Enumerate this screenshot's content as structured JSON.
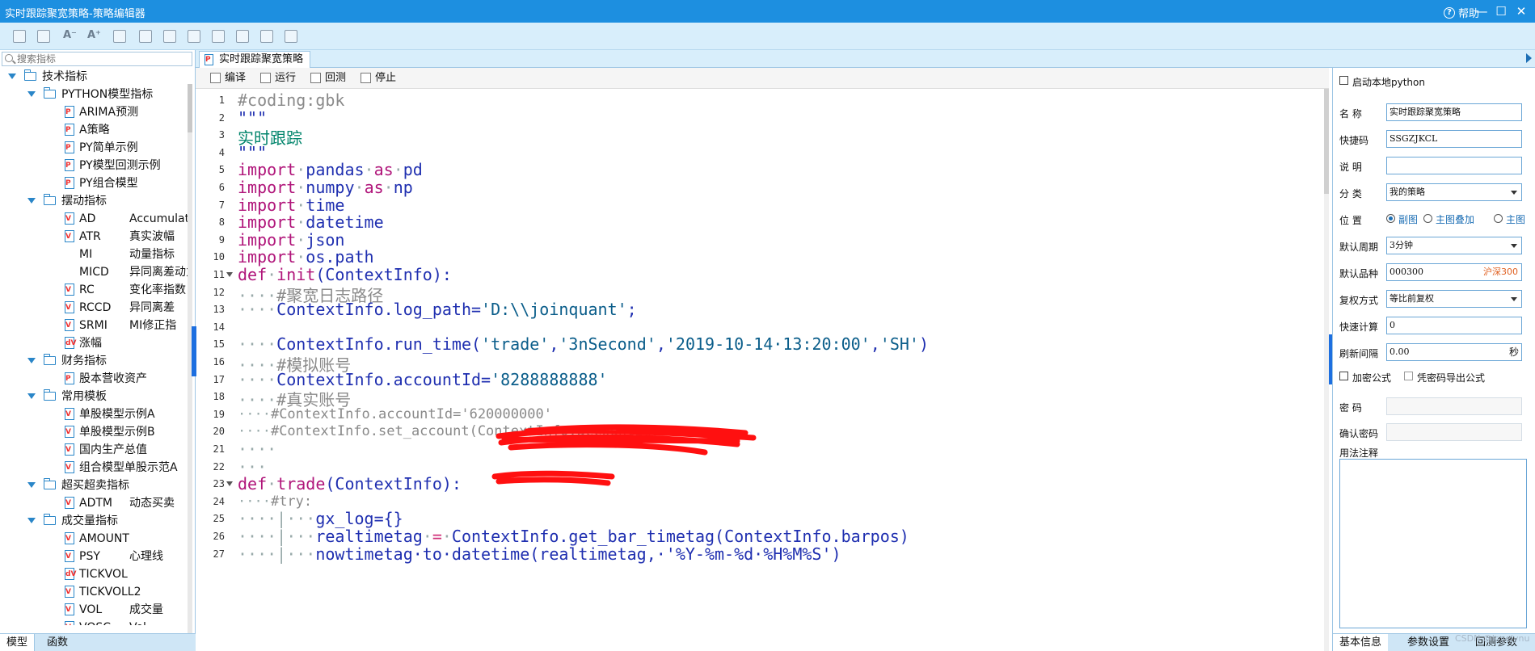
{
  "window": {
    "title": "实时跟踪聚宽策略-策略编辑器",
    "help_label": "帮助",
    "minimize_glyph": "—",
    "maximize_glyph": "☐",
    "close_glyph": "✕"
  },
  "toolbar": {
    "icons": [
      "save-icon",
      "save-all-icon",
      "font-decrease-icon",
      "font-increase-icon",
      "import-icon",
      "export-icon",
      "check-icon",
      "copy-icon",
      "paste-icon",
      "download-icon",
      "upload-icon",
      "lock-icon"
    ],
    "font_small": "A⁻",
    "font_large": "A⁺"
  },
  "left_panel": {
    "search_placeholder": "搜索指标",
    "tree": [
      {
        "level": 0,
        "type": "folder",
        "label": "技术指标"
      },
      {
        "level": 1,
        "type": "folder",
        "label": "PYTHON模型指标"
      },
      {
        "level": 2,
        "type": "doc",
        "mark": "P",
        "label": "ARIMA预测"
      },
      {
        "level": 2,
        "type": "doc",
        "mark": "P",
        "label": "A策略"
      },
      {
        "level": 2,
        "type": "doc",
        "mark": "P",
        "label": "PY简单示例"
      },
      {
        "level": 2,
        "type": "doc",
        "mark": "P",
        "label": "PY模型回测示例"
      },
      {
        "level": 2,
        "type": "doc",
        "mark": "P",
        "label": "PY组合模型"
      },
      {
        "level": 1,
        "type": "folder",
        "label": "摆动指标"
      },
      {
        "level": 2,
        "type": "doc",
        "mark": "V",
        "label": "AD",
        "desc": "Accumulat"
      },
      {
        "level": 2,
        "type": "doc",
        "mark": "V",
        "label": "ATR",
        "desc": "真实波幅"
      },
      {
        "level": 2,
        "type": "none",
        "label": "MI",
        "desc": "动量指标"
      },
      {
        "level": 2,
        "type": "none",
        "label": "MICD",
        "desc": "异同离差动力"
      },
      {
        "level": 2,
        "type": "doc",
        "mark": "V",
        "label": "RC",
        "desc": "变化率指数"
      },
      {
        "level": 2,
        "type": "doc",
        "mark": "V",
        "label": "RCCD",
        "desc": "异同离差"
      },
      {
        "level": 2,
        "type": "doc",
        "mark": "V",
        "label": "SRMI",
        "desc": "MI修正指"
      },
      {
        "level": 2,
        "type": "doc",
        "mark": "dV",
        "label": "涨幅"
      },
      {
        "level": 1,
        "type": "folder",
        "label": "财务指标"
      },
      {
        "level": 2,
        "type": "doc",
        "mark": "P",
        "label": "股本营收资产"
      },
      {
        "level": 1,
        "type": "folder",
        "label": "常用模板"
      },
      {
        "level": 2,
        "type": "doc",
        "mark": "V",
        "label": "单股模型示例A"
      },
      {
        "level": 2,
        "type": "doc",
        "mark": "V",
        "label": "单股模型示例B"
      },
      {
        "level": 2,
        "type": "doc",
        "mark": "V",
        "label": "国内生产总值"
      },
      {
        "level": 2,
        "type": "doc",
        "mark": "V",
        "label": "组合模型单股示范A"
      },
      {
        "level": 1,
        "type": "folder",
        "label": "超买超卖指标"
      },
      {
        "level": 2,
        "type": "doc",
        "mark": "V",
        "label": "ADTM",
        "desc": "动态买卖"
      },
      {
        "level": 1,
        "type": "folder",
        "label": "成交量指标"
      },
      {
        "level": 2,
        "type": "doc",
        "mark": "V",
        "label": "AMOUNT"
      },
      {
        "level": 2,
        "type": "doc",
        "mark": "V",
        "label": "PSY",
        "desc": "心理线"
      },
      {
        "level": 2,
        "type": "doc",
        "mark": "dV",
        "label": "TICKVOL"
      },
      {
        "level": 2,
        "type": "doc",
        "mark": "V",
        "label": "TICKVOLL2"
      },
      {
        "level": 2,
        "type": "doc",
        "mark": "V",
        "label": "VOL",
        "desc": "成交量"
      },
      {
        "level": 2,
        "type": "doc",
        "mark": "V",
        "label": "VOSC",
        "desc": "Vol"
      }
    ],
    "bottom_tabs": [
      "模型",
      "函数"
    ]
  },
  "editor": {
    "tab_title": "实时跟踪聚宽策略",
    "actions": [
      {
        "name": "compile",
        "label": "编译"
      },
      {
        "name": "run",
        "label": "运行"
      },
      {
        "name": "backtest",
        "label": "回测"
      },
      {
        "name": "stop",
        "label": "停止"
      }
    ],
    "lines": [
      {
        "n": "1",
        "tokens": [
          [
            "comment",
            "#coding:gbk"
          ]
        ]
      },
      {
        "n": "2",
        "tokens": [
          [
            "blue",
            "\"\"\""
          ]
        ]
      },
      {
        "n": "3",
        "tokens": [
          [
            "green",
            "实时跟踪"
          ]
        ]
      },
      {
        "n": "4",
        "tokens": [
          [
            "blue",
            "\"\"\""
          ]
        ]
      },
      {
        "n": "5",
        "tokens": [
          [
            "kw",
            "import"
          ],
          [
            "dot",
            "·"
          ],
          [
            "blue",
            "pandas"
          ],
          [
            "dot",
            "·"
          ],
          [
            "kw",
            "as"
          ],
          [
            "dot",
            "·"
          ],
          [
            "blue",
            "pd"
          ]
        ]
      },
      {
        "n": "6",
        "tokens": [
          [
            "kw",
            "import"
          ],
          [
            "dot",
            "·"
          ],
          [
            "blue",
            "numpy"
          ],
          [
            "dot",
            "·"
          ],
          [
            "kw",
            "as"
          ],
          [
            "dot",
            "·"
          ],
          [
            "blue",
            "np"
          ]
        ]
      },
      {
        "n": "7",
        "tokens": [
          [
            "kw",
            "import"
          ],
          [
            "dot",
            "·"
          ],
          [
            "blue",
            "time"
          ]
        ]
      },
      {
        "n": "8",
        "tokens": [
          [
            "kw",
            "import"
          ],
          [
            "dot",
            "·"
          ],
          [
            "blue",
            "datetime"
          ]
        ]
      },
      {
        "n": "9",
        "tokens": [
          [
            "kw",
            "import"
          ],
          [
            "dot",
            "·"
          ],
          [
            "blue",
            "json"
          ]
        ]
      },
      {
        "n": "10",
        "tokens": [
          [
            "kw",
            "import"
          ],
          [
            "dot",
            "·"
          ],
          [
            "blue",
            "os.path"
          ]
        ]
      },
      {
        "n": "11",
        "fold": true,
        "tokens": [
          [
            "kw",
            "def"
          ],
          [
            "dot",
            "·"
          ],
          [
            "kw",
            "init"
          ],
          [
            "blue",
            "(ContextInfo):"
          ]
        ]
      },
      {
        "n": "12",
        "tokens": [
          [
            "dot",
            "····"
          ],
          [
            "comment",
            "#聚宽日志路径"
          ]
        ]
      },
      {
        "n": "13",
        "tokens": [
          [
            "dot",
            "····"
          ],
          [
            "blue",
            "ContextInfo.log_path="
          ],
          [
            "str",
            "'D:\\\\joinquant'"
          ],
          [
            "blue",
            ";"
          ]
        ]
      },
      {
        "n": "14",
        "tokens": []
      },
      {
        "n": "15",
        "tokens": [
          [
            "dot",
            "····"
          ],
          [
            "blue",
            "ContextInfo.run_time("
          ],
          [
            "str",
            "'trade'"
          ],
          [
            "blue",
            ","
          ],
          [
            "str",
            "'3nSecond'"
          ],
          [
            "blue",
            ","
          ],
          [
            "str",
            "'2019-10-14·13:20:00'"
          ],
          [
            "blue",
            ","
          ],
          [
            "str",
            "'SH'"
          ],
          [
            "blue",
            ")"
          ]
        ]
      },
      {
        "n": "16",
        "tokens": [
          [
            "dot",
            "····"
          ],
          [
            "comment",
            "#模拟账号"
          ]
        ]
      },
      {
        "n": "17",
        "tokens": [
          [
            "dot",
            "····"
          ],
          [
            "blue",
            "ContextInfo.accountId="
          ],
          [
            "str",
            "'8288888888'"
          ]
        ]
      },
      {
        "n": "18",
        "tokens": [
          [
            "dot",
            "····"
          ],
          [
            "comment",
            "#真实账号"
          ]
        ]
      },
      {
        "n": "19",
        "small": true,
        "tokens": [
          [
            "dot",
            "····"
          ],
          [
            "comment",
            "#ContextInfo.accountId='620000000'"
          ]
        ]
      },
      {
        "n": "20",
        "small": true,
        "tokens": [
          [
            "dot",
            "····"
          ],
          [
            "comment",
            "#ContextInfo.set_account(ContextInfo.accountId)"
          ]
        ]
      },
      {
        "n": "21",
        "tokens": [
          [
            "dot",
            "····"
          ]
        ]
      },
      {
        "n": "22",
        "tokens": [
          [
            "dot",
            "···"
          ]
        ]
      },
      {
        "n": "23",
        "fold": true,
        "tokens": [
          [
            "kw",
            "def"
          ],
          [
            "dot",
            "·"
          ],
          [
            "kw",
            "trade"
          ],
          [
            "blue",
            "(ContextInfo):"
          ]
        ]
      },
      {
        "n": "24",
        "small": true,
        "tokens": [
          [
            "dot",
            "····"
          ],
          [
            "comment",
            "#try:"
          ]
        ]
      },
      {
        "n": "25",
        "tokens": [
          [
            "dot",
            "····|···"
          ],
          [
            "blue",
            "gx_log={}"
          ]
        ]
      },
      {
        "n": "26",
        "tokens": [
          [
            "dot",
            "····|···"
          ],
          [
            "blue",
            "realtimetag"
          ],
          [
            "dot",
            "·"
          ],
          [
            "op",
            "="
          ],
          [
            "dot",
            "·"
          ],
          [
            "blue",
            "ContextInfo.get_bar_timetag(ContextInfo.barpos)"
          ]
        ]
      },
      {
        "n": "27",
        "tokens": [
          [
            "dot",
            "····|···"
          ],
          [
            "blue",
            "nowtimetag·to·datetime(realtimetag,·'%Y-%m-%d·%H%M%S')"
          ]
        ]
      }
    ]
  },
  "properties": {
    "enable_local_python": "启动本地python",
    "name_label": "名  称",
    "name_value": "实时跟踪聚宽策略",
    "shortcut_label": "快捷码",
    "shortcut_value": "SSGZJKCL",
    "desc_label": "说  明",
    "desc_value": "",
    "category_label": "分  类",
    "category_value": "我的策略",
    "position_label": "位  置",
    "position_options": [
      "副图",
      "主图叠加",
      "主图"
    ],
    "period_label": "默认周期",
    "period_value": "3分钟",
    "symbol_label": "默认品种",
    "symbol_value": "000300",
    "symbol_name": "沪深300",
    "adjust_label": "复权方式",
    "adjust_value": "等比前复权",
    "quickcalc_label": "快速计算",
    "quickcalc_value": "0",
    "refresh_label": "刷新间隔",
    "refresh_value": "0.00",
    "refresh_unit": "秒",
    "encrypt_label": "加密公式",
    "export_pwd_label": "凭密码导出公式",
    "password_label": "密  码",
    "confirm_label": "确认密码",
    "notes_label": "用法注释",
    "tabs": [
      "基本信息",
      "参数设置",
      "回测参数"
    ]
  },
  "watermark": "CSDN @lovelynu"
}
